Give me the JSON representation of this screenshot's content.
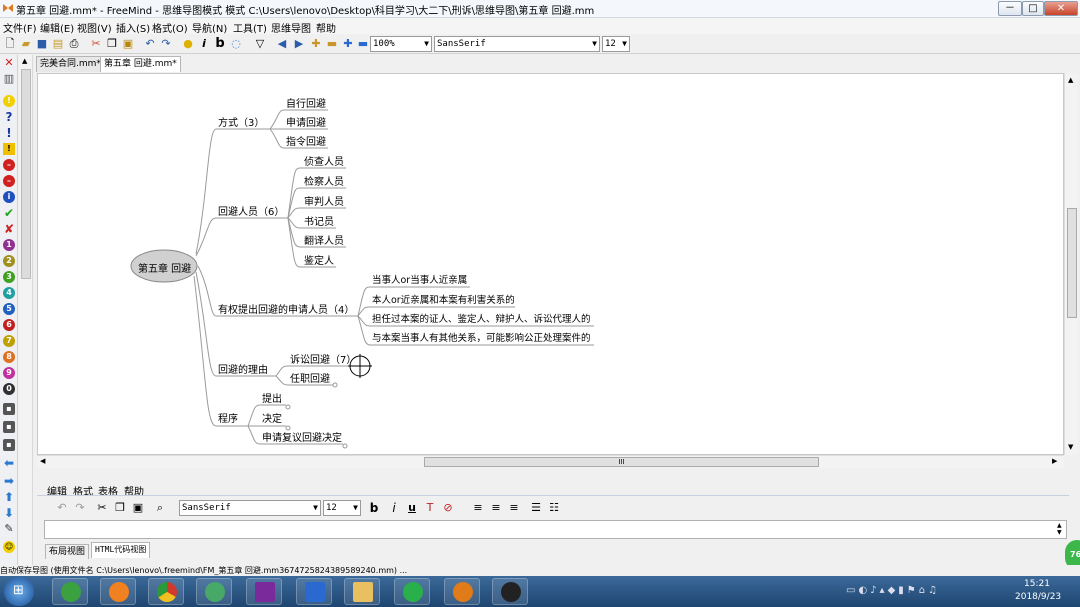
{
  "window": {
    "title": "第五章 回避.mm* - FreeMind - 思维导图模式 模式 C:\\Users\\lenovo\\Desktop\\科目学习\\大二下\\刑诉\\思维导图\\第五章 回避.mm",
    "minimize": "－",
    "maximize": "□",
    "close": "✕"
  },
  "menu": [
    "文件(F)",
    "编辑(E)",
    "视图(V)",
    "插入(S)",
    "格式(O)",
    "导航(N)",
    "工具(T)",
    "思维导图",
    "帮助"
  ],
  "toolbar": {
    "zoom": "100%",
    "font": "SansSerif",
    "size": "12"
  },
  "tabs": [
    "完美合同.mm*",
    "第五章 回避.mm*"
  ],
  "mindmap": {
    "root": "第五章 回避",
    "branches": [
      {
        "label": "方式（3）",
        "children": [
          "自行回避",
          "申请回避",
          "指令回避"
        ]
      },
      {
        "label": "回避人员（6）",
        "children": [
          "侦查人员",
          "检察人员",
          "审判人员",
          "书记员",
          "翻译人员",
          "鉴定人"
        ]
      },
      {
        "label": "有权提出回避的申请人员（4）",
        "children": [
          "当事人or当事人近亲属",
          "本人or近亲属和本案有利害关系的",
          "担任过本案的证人、鉴定人、辩护人、诉讼代理人的",
          "与本案当事人有其他关系，可能影响公正处理案件的"
        ]
      },
      {
        "label": "回避的理由",
        "children": [
          "诉讼回避（7）",
          "任职回避"
        ]
      },
      {
        "label": "程序",
        "children": [
          "提出",
          "决定",
          "申请复议回避决定"
        ]
      }
    ]
  },
  "hscroll_label": "III",
  "notes": {
    "menu": [
      "编辑",
      "格式",
      "表格",
      "帮助"
    ],
    "font": "SansSerif",
    "size": "12",
    "view_tabs": [
      "布局视图",
      "HTML代码视图"
    ]
  },
  "status": "自动保存导图 (使用文件名 C:\\Users\\lenovo\\.freemind\\FM_第五章 回避.mm36747258243895​89240.mm) ...",
  "taskbar": {
    "time": "15:21",
    "date": "2018/9/23",
    "badge": "76"
  },
  "colors": {
    "edge": "#9a9a9a",
    "root_fill": "#d0d0d0",
    "taskbar": "#1e4570"
  }
}
